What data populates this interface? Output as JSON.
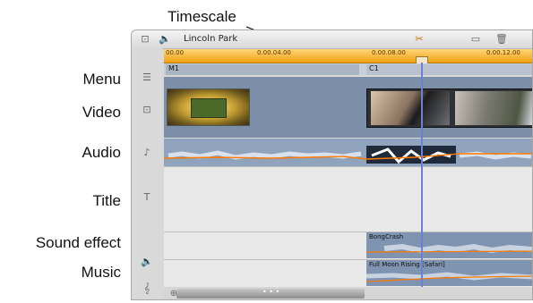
{
  "callouts": {
    "timescale": "Timescale",
    "menu": "Menu",
    "video": "Video",
    "audio": "Audio",
    "title": "Title",
    "sound_effect": "Sound effect",
    "music": "Music"
  },
  "toolbar": {
    "project_name": "Lincoln Park"
  },
  "ruler": {
    "ticks": [
      "00.00",
      "0.00.04.00",
      "0.00.08.00",
      "0.00.12.00"
    ]
  },
  "menu_track": {
    "clips": [
      "M1",
      "C1"
    ]
  },
  "sfx_track": {
    "clip_label": "BongCrash"
  },
  "music_track": {
    "clip_label": "Full Moon Rising [Safari]"
  },
  "scrollbar": {
    "grip": "• • •"
  },
  "icons": [
    "filmstrip-icon",
    "speaker-icon",
    "scissors-icon",
    "film-icon",
    "trash-icon",
    "menu-icon",
    "video-icon",
    "audio-icon",
    "title-icon",
    "sound-effect-icon",
    "music-clef-icon",
    "zoom-in-icon",
    "zoom-out-icon"
  ],
  "colors": {
    "ruler": "#f19f10",
    "playhead": "#6e7fd6",
    "volume_line": "#ff7a00"
  }
}
